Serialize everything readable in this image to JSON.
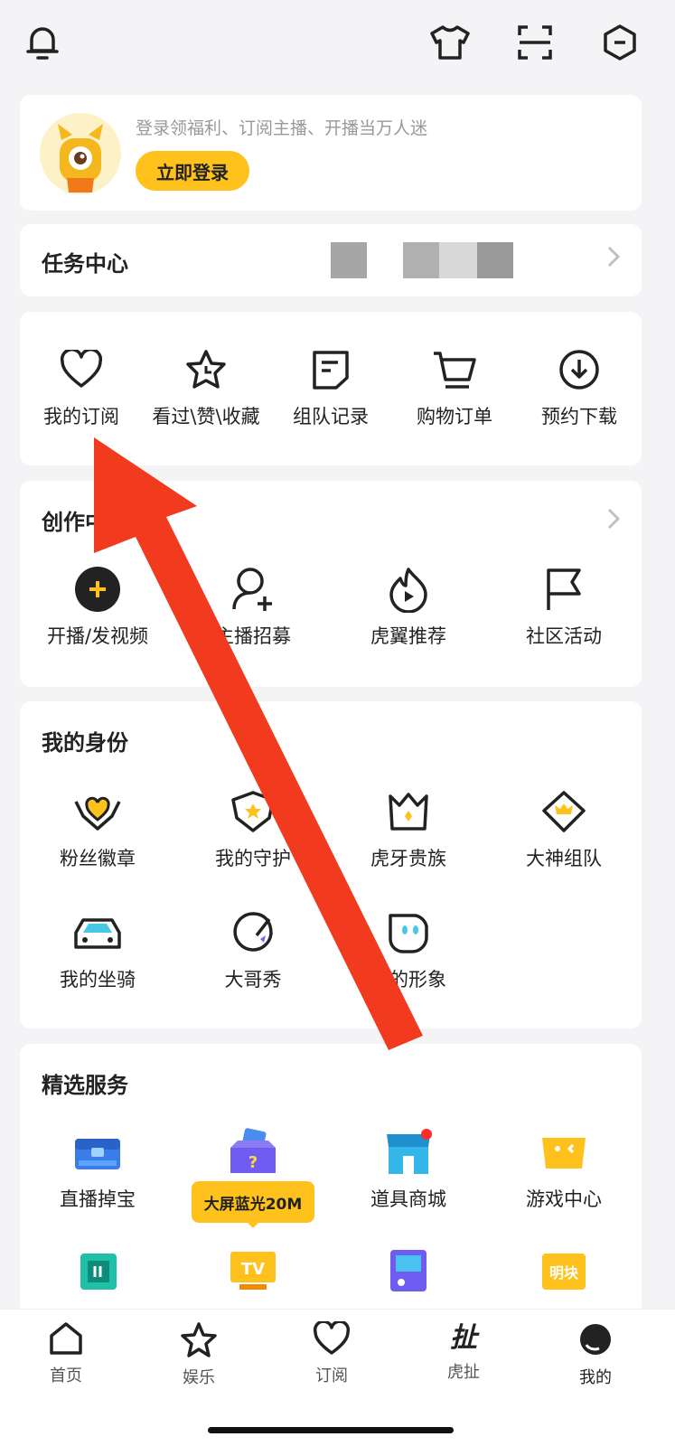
{
  "topbar": {
    "bell_icon": "bell-icon",
    "shirt_icon": "tshirt-icon",
    "scan_icon": "scan-icon",
    "settings_icon": "hexagon-minus-icon"
  },
  "login": {
    "slogan": "登录领福利、订阅主播、开播当万人迷",
    "button": "立即登录"
  },
  "task_center": {
    "title": "任务中心"
  },
  "shortcuts": [
    {
      "label": "我的订阅",
      "icon": "heart-icon"
    },
    {
      "label": "看过\\赞\\收藏",
      "icon": "star-clock-icon"
    },
    {
      "label": "组队记录",
      "icon": "note-icon"
    },
    {
      "label": "购物订单",
      "icon": "cart-icon"
    },
    {
      "label": "预约下载",
      "icon": "download-icon"
    }
  ],
  "creator": {
    "title": "创作中心",
    "items": [
      {
        "label": "开播/发视频",
        "icon": "plus-circle-icon"
      },
      {
        "label": "主播招募",
        "icon": "user-add-icon"
      },
      {
        "label": "虎翼推荐",
        "icon": "flame-play-icon"
      },
      {
        "label": "社区活动",
        "icon": "flag-icon"
      }
    ]
  },
  "identity": {
    "title": "我的身份",
    "items": [
      {
        "label": "粉丝徽章",
        "icon": "heart-badge-icon"
      },
      {
        "label": "我的守护",
        "icon": "shield-crown-icon"
      },
      {
        "label": "虎牙贵族",
        "icon": "crown-icon"
      },
      {
        "label": "大神组队",
        "icon": "diamond-crown-icon"
      },
      {
        "label": "我的坐骑",
        "icon": "car-icon"
      },
      {
        "label": "大哥秀",
        "icon": "sticker-icon"
      },
      {
        "label": "我的形象",
        "icon": "avatar-face-icon"
      }
    ]
  },
  "services": {
    "title": "精选服务",
    "items": [
      {
        "label": "直播掉宝",
        "icon": "treasure-chest-icon"
      },
      {
        "label": "",
        "icon": "mystery-box-icon"
      },
      {
        "label": "道具商城",
        "icon": "shop-icon"
      },
      {
        "label": "游戏中心",
        "icon": "game-pad-icon"
      }
    ],
    "tooltip": "大屏蓝光20M",
    "row2": [
      {
        "icon": "teal-card-icon"
      },
      {
        "icon": "tv-icon",
        "text": "TV"
      },
      {
        "icon": "handheld-icon"
      },
      {
        "icon": "yellow-tag-icon",
        "text": "明块"
      }
    ]
  },
  "nav": [
    {
      "label": "首页",
      "icon": "home-icon"
    },
    {
      "label": "娱乐",
      "icon": "star-icon"
    },
    {
      "label": "订阅",
      "icon": "heart-icon"
    },
    {
      "label": "虎扯",
      "icon": "huche-icon",
      "glyph": "扯"
    },
    {
      "label": "我的",
      "icon": "profile-icon"
    }
  ],
  "colors": {
    "accent": "#ffc21c",
    "arrow": "#f13a1e",
    "dot": "#ff2b2b"
  }
}
